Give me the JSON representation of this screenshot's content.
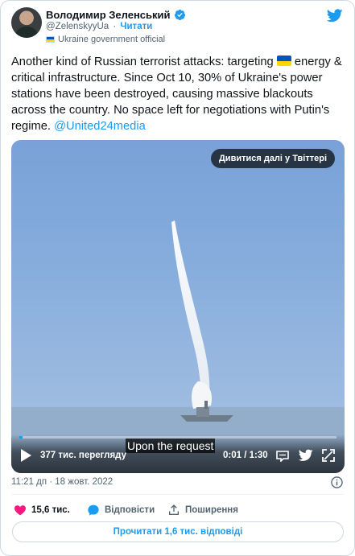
{
  "author": {
    "display_name": "Володимир Зеленський",
    "handle": "@ZelenskyyUa",
    "separator": "·",
    "follow_label": "Читати",
    "affiliation": "Ukraine government official"
  },
  "tweet": {
    "text_before_flag": "Another kind of Russian terrorist attacks: targeting",
    "text_after_flag": "energy & critical infrastructure. Since Oct 10, 30% of Ukraine's power stations have been destroyed, causing massive blackouts across the country. No space left for negotiations with Putin's regime.",
    "mention": "@United24media"
  },
  "media": {
    "watch_more_label": "Дивитися далі у Твіттері",
    "subtitle": "Upon the request",
    "views": "377 тис. перегляду",
    "time": "0:01 / 1:30",
    "progress": 0.011
  },
  "meta": {
    "timestamp": "11:21 дп · 18 жовт. 2022"
  },
  "actions": {
    "likes": "15,6 тис.",
    "reply_label": "Відповісти",
    "share_label": "Поширення",
    "read_replies_label": "Прочитати 1,6 тис. відповіді"
  },
  "colors": {
    "accent": "#1d9bf0",
    "like": "#f91880",
    "flag_blue": "#0057b7",
    "flag_yellow": "#ffd700"
  },
  "icons": [
    "avatar",
    "verified-icon",
    "twitter-logo",
    "flag-icon",
    "play-icon",
    "cc-icon",
    "twitter-bird-icon",
    "fullscreen-icon",
    "info-icon",
    "heart-icon",
    "reply-icon",
    "share-icon"
  ]
}
